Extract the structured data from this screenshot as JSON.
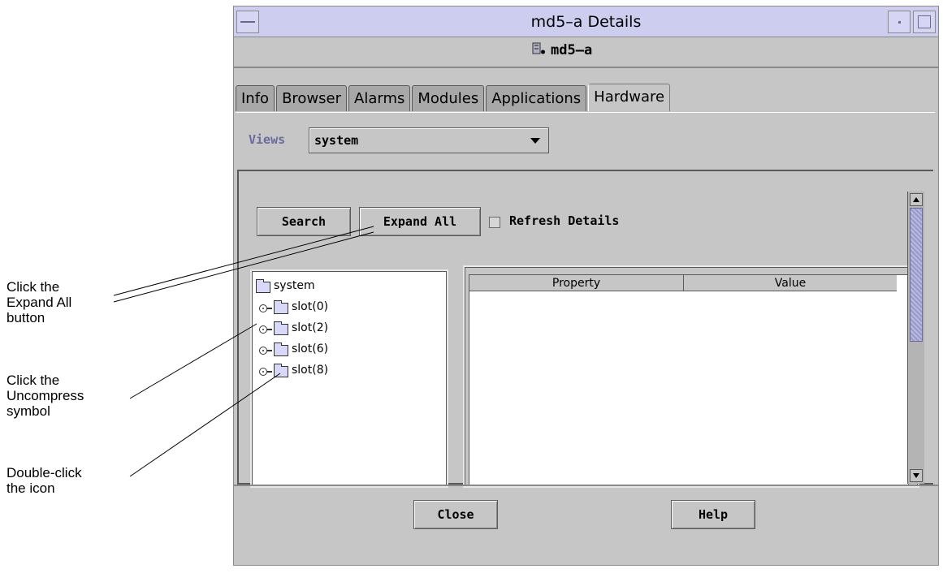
{
  "annotations": [
    {
      "lines": [
        "Click the",
        "Expand All",
        "button"
      ]
    },
    {
      "lines": [
        "Click the",
        "Uncompress",
        "symbol"
      ]
    },
    {
      "lines": [
        "Double-click",
        "the icon"
      ]
    }
  ],
  "window": {
    "title": "md5–a Details",
    "host_name": "md5–a",
    "tabs": [
      "Info",
      "Browser",
      "Alarms",
      "Modules",
      "Applications",
      "Hardware"
    ],
    "active_tab": "Hardware",
    "views": {
      "label": "Views",
      "selected": "system"
    },
    "toolbar": {
      "search_label": "Search",
      "expand_all_label": "Expand All",
      "refresh_label": "Refresh Details",
      "refresh_checked": false
    },
    "tree": {
      "root": "system",
      "children": [
        "slot(0)",
        "slot(2)",
        "slot(6)",
        "slot(8)"
      ]
    },
    "table": {
      "columns": [
        "Property",
        "Value"
      ]
    },
    "footer": {
      "close_label": "Close",
      "help_label": "Help"
    }
  }
}
